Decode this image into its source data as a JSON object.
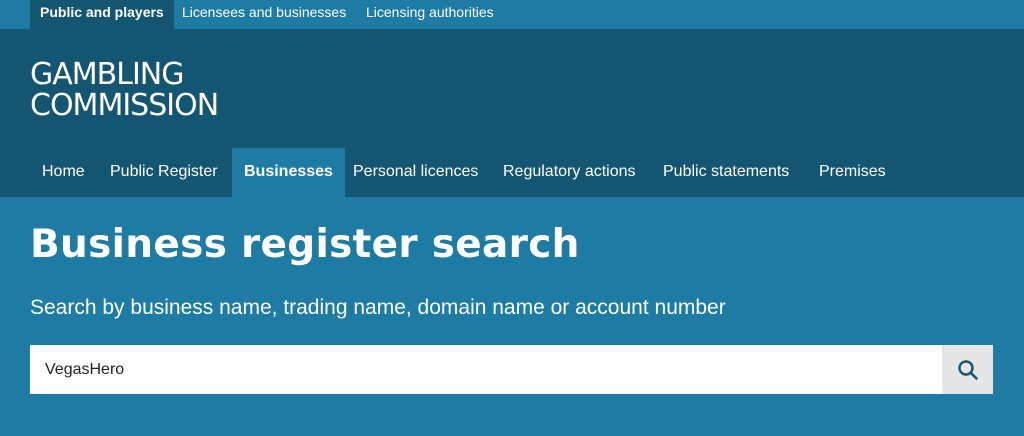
{
  "audience_tabs": [
    {
      "label": "Public and players"
    },
    {
      "label": "Licensees and businesses"
    },
    {
      "label": "Licensing authorities"
    }
  ],
  "logo": {
    "line1": "GAMBLING",
    "line2": "COMMISSION"
  },
  "main_nav": [
    {
      "label": "Home"
    },
    {
      "label": "Public Register"
    },
    {
      "label": "Businesses"
    },
    {
      "label": "Personal licences"
    },
    {
      "label": "Regulatory actions"
    },
    {
      "label": "Public statements"
    },
    {
      "label": "Premises"
    }
  ],
  "page": {
    "title": "Business register search",
    "hint": "Search by business name, trading name, domain name or account number"
  },
  "search": {
    "value": "VegasHero",
    "button_icon": "search-icon"
  },
  "colors": {
    "page_bg": "#1e7ba3",
    "header_bg": "#145672",
    "button_bg": "#e6e6e6",
    "icon": "#145672"
  }
}
